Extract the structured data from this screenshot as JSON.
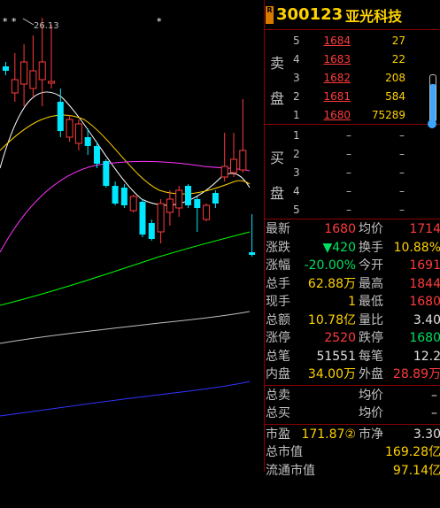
{
  "chart": {
    "high_label": "26.13",
    "markers": [
      "*",
      "*",
      "*"
    ],
    "candles": [
      {
        "o": 80,
        "c": 75,
        "h": 70,
        "l": 85,
        "up": false
      },
      {
        "o": 90,
        "c": 105,
        "h": 60,
        "l": 115,
        "up": true
      },
      {
        "o": 70,
        "c": 95,
        "h": 50,
        "l": 120,
        "up": true
      },
      {
        "o": 80,
        "c": 100,
        "h": 40,
        "l": 110,
        "up": true
      },
      {
        "o": 70,
        "c": 90,
        "h": 20,
        "l": 120,
        "up": true
      },
      {
        "o": 92,
        "c": 92,
        "h": 28,
        "l": 100,
        "up": true
      },
      {
        "o": 115,
        "c": 148,
        "h": 100,
        "l": 155,
        "up": false
      },
      {
        "o": 135,
        "c": 155,
        "h": 130,
        "l": 160,
        "up": true
      },
      {
        "o": 140,
        "c": 162,
        "h": 135,
        "l": 170,
        "up": true
      },
      {
        "o": 155,
        "c": 165,
        "h": 145,
        "l": 175,
        "up": false
      },
      {
        "o": 165,
        "c": 185,
        "h": 160,
        "l": 190,
        "up": false
      },
      {
        "o": 182,
        "c": 210,
        "h": 180,
        "l": 212,
        "up": false
      },
      {
        "o": 210,
        "c": 230,
        "h": 205,
        "l": 232,
        "up": false
      },
      {
        "o": 212,
        "c": 232,
        "h": 208,
        "l": 235,
        "up": false
      },
      {
        "o": 222,
        "c": 238,
        "h": 220,
        "l": 240,
        "up": true
      },
      {
        "o": 228,
        "c": 265,
        "h": 225,
        "l": 268,
        "up": false
      },
      {
        "o": 252,
        "c": 270,
        "h": 248,
        "l": 272,
        "up": false
      },
      {
        "o": 230,
        "c": 262,
        "h": 225,
        "l": 275,
        "up": true
      },
      {
        "o": 225,
        "c": 240,
        "h": 215,
        "l": 255,
        "up": true
      },
      {
        "o": 215,
        "c": 235,
        "h": 210,
        "l": 245,
        "up": true
      },
      {
        "o": 210,
        "c": 232,
        "h": 208,
        "l": 235,
        "up": false
      },
      {
        "o": 225,
        "c": 235,
        "h": 222,
        "l": 262,
        "up": false
      },
      {
        "o": 232,
        "c": 248,
        "h": 230,
        "l": 250,
        "up": true
      },
      {
        "o": 218,
        "c": 230,
        "h": 215,
        "l": 235,
        "up": false
      },
      {
        "o": 188,
        "c": 200,
        "h": 150,
        "l": 205,
        "up": true
      },
      {
        "o": 180,
        "c": 195,
        "h": 150,
        "l": 200,
        "up": true
      },
      {
        "o": 170,
        "c": 192,
        "h": 112,
        "l": 195,
        "up": true
      },
      {
        "o": 285,
        "c": 288,
        "h": 242,
        "l": 290,
        "up": false
      }
    ]
  },
  "quote": {
    "code": "300123",
    "name": "亚光科技",
    "badge": "R",
    "sell_label": [
      "卖",
      "盘"
    ],
    "buy_label": [
      "买",
      "盘"
    ],
    "sell": [
      {
        "level": "5",
        "price": "1684",
        "vol": "27"
      },
      {
        "level": "4",
        "price": "1683",
        "vol": "22"
      },
      {
        "level": "3",
        "price": "1682",
        "vol": "208"
      },
      {
        "level": "2",
        "price": "1681",
        "vol": "584"
      },
      {
        "level": "1",
        "price": "1680",
        "vol": "75289"
      }
    ],
    "buy": [
      {
        "level": "1",
        "price": "–",
        "vol": "–"
      },
      {
        "level": "2",
        "price": "–",
        "vol": "–"
      },
      {
        "level": "3",
        "price": "–",
        "vol": "–"
      },
      {
        "level": "4",
        "price": "–",
        "vol": "–"
      },
      {
        "level": "5",
        "price": "–",
        "vol": "–"
      }
    ],
    "stats": [
      {
        "k1": "最新",
        "v1": "1680",
        "c1": "red",
        "k2": "均价",
        "v2": "1714",
        "c2": "red"
      },
      {
        "k1": "涨跌",
        "v1": "▼420",
        "c1": "grn",
        "k2": "换手",
        "v2": "10.88%",
        "c2": "yel"
      },
      {
        "k1": "涨幅",
        "v1": "-20.00%",
        "c1": "grn",
        "k2": "今开",
        "v2": "1691",
        "c2": "red"
      },
      {
        "k1": "总手",
        "v1": "62.88万",
        "c1": "yel",
        "k2": "最高",
        "v2": "1844",
        "c2": "red"
      },
      {
        "k1": "现手",
        "v1": "1",
        "c1": "yel",
        "k2": "最低",
        "v2": "1680",
        "c2": "red"
      },
      {
        "k1": "总额",
        "v1": "10.78亿",
        "c1": "yel",
        "k2": "量比",
        "v2": "3.40",
        "c2": "wht"
      },
      {
        "k1": "涨停",
        "v1": "2520",
        "c1": "red",
        "k2": "跌停",
        "v2": "1680",
        "c2": "grn"
      },
      {
        "k1": "总笔",
        "v1": "51551",
        "c1": "wht",
        "k2": "每笔",
        "v2": "12.2",
        "c2": "wht"
      },
      {
        "k1": "内盘",
        "v1": "34.00万",
        "c1": "yel",
        "k2": "外盘",
        "v2": "28.89万",
        "c2": "red"
      }
    ],
    "stats2": [
      {
        "k1": "总卖",
        "v1": "–",
        "k2": "均价",
        "v2": "–"
      },
      {
        "k1": "总买",
        "v1": "–",
        "k2": "均价",
        "v2": "–"
      }
    ],
    "stats3": [
      {
        "k1": "市盈",
        "v1": "171.87②",
        "k2": "市净",
        "v2": "3.30"
      },
      {
        "k1": "总市值",
        "v1": "",
        "k2": "",
        "v2": "169.28亿"
      },
      {
        "k1": "流通市值",
        "v1": "",
        "k2": "",
        "v2": "97.14亿"
      }
    ],
    "gauge_level": 0.8
  },
  "colors": {
    "up": "#ff3b3b",
    "down": "#00e8ff",
    "ma5": "#ffffff",
    "ma10": "#ffd200",
    "ma20": "#ff33ff",
    "ma60": "#00ff00",
    "ma120": "#c0c0c0",
    "ma250": "#3333ff",
    "border": "#8a0000"
  }
}
